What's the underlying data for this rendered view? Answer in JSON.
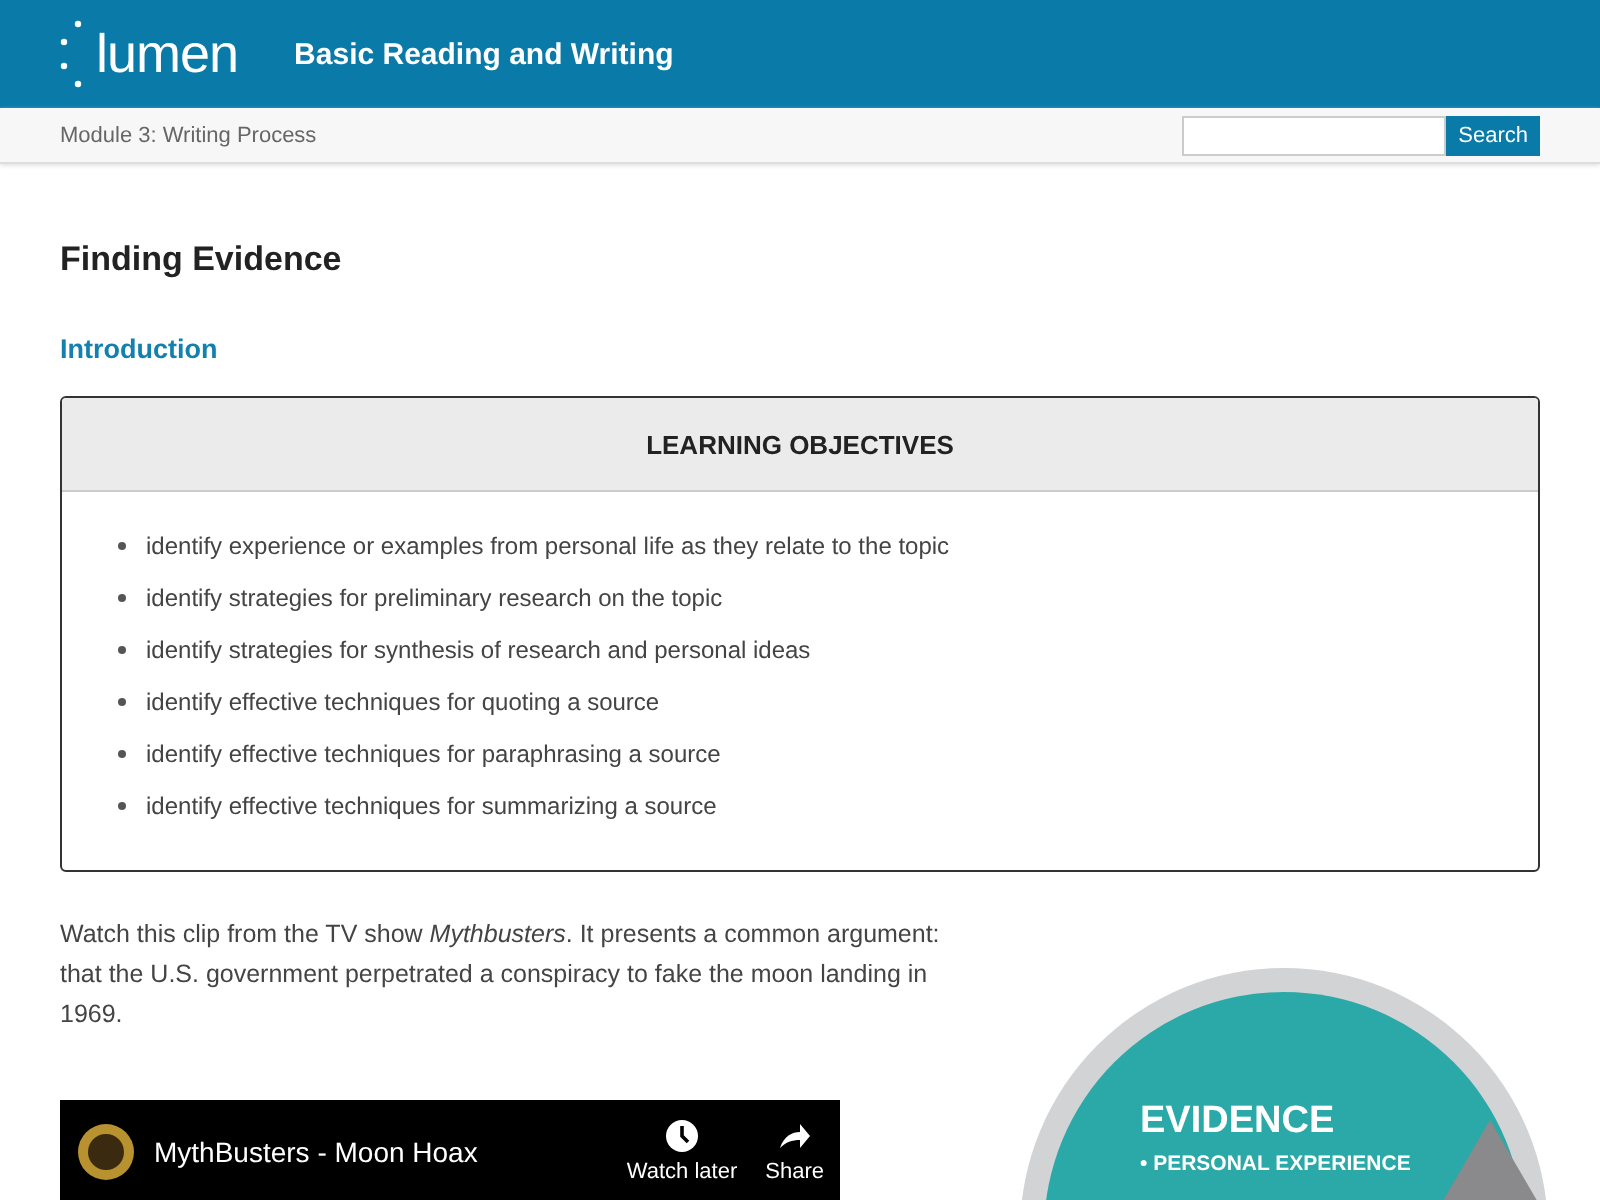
{
  "header": {
    "logo": "lumen",
    "course_title": "Basic Reading and Writing"
  },
  "breadcrumb": "Module 3: Writing Process",
  "search": {
    "button": "Search"
  },
  "page_title": "Finding Evidence",
  "section_heading": "Introduction",
  "objectives": {
    "title": "LEARNING OBJECTIVES",
    "items": [
      "identify experience or examples from personal life as they relate to the topic",
      "identify strategies for preliminary research on the topic",
      "identify strategies for synthesis of research and personal ideas",
      "identify effective techniques for quoting a source",
      "identify effective techniques for paraphrasing a source",
      "identify effective techniques for summarizing a source"
    ]
  },
  "intro_paragraph": "Watch this clip from the TV show *Mythbusters*. It presents a common argument: that the U.S. government perpetrated a conspiracy to fake the moon landing in 1969.",
  "video": {
    "title": "MythBusters - Moon Hoax",
    "actions": [
      "Watch later",
      "Share"
    ]
  },
  "graphic": {
    "heading": "EVIDENCE",
    "bullet": "• PERSONAL EXPERIENCE"
  }
}
